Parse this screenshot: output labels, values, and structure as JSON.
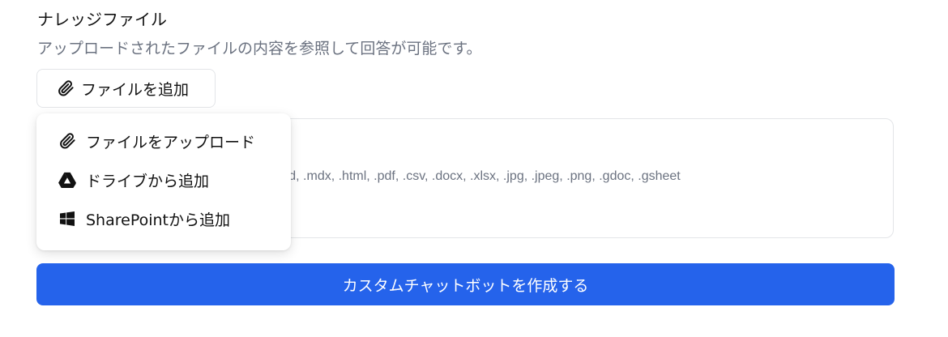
{
  "knowledge": {
    "title": "ナレッジファイル",
    "description": "アップロードされたファイルの内容を参照して回答が可能です。",
    "add_file_label": "ファイルを追加"
  },
  "menu": {
    "items": [
      {
        "label": "ファイルをアップロード",
        "icon": "paperclip-icon"
      },
      {
        "label": "ドライブから追加",
        "icon": "google-drive-icon"
      },
      {
        "label": "SharePointから追加",
        "icon": "windows-icon"
      }
    ]
  },
  "dropzone": {
    "types_text": ".txt, .md, .mdx, .html, .pdf, .csv, .docx, .xlsx, .jpg, .jpeg, .png, .gdoc, .gsheet"
  },
  "actions": {
    "create_label": "カスタムチャットボットを作成する"
  },
  "colors": {
    "primary": "#2563eb",
    "muted_text": "#6b7280",
    "border": "#e3e5e8"
  }
}
